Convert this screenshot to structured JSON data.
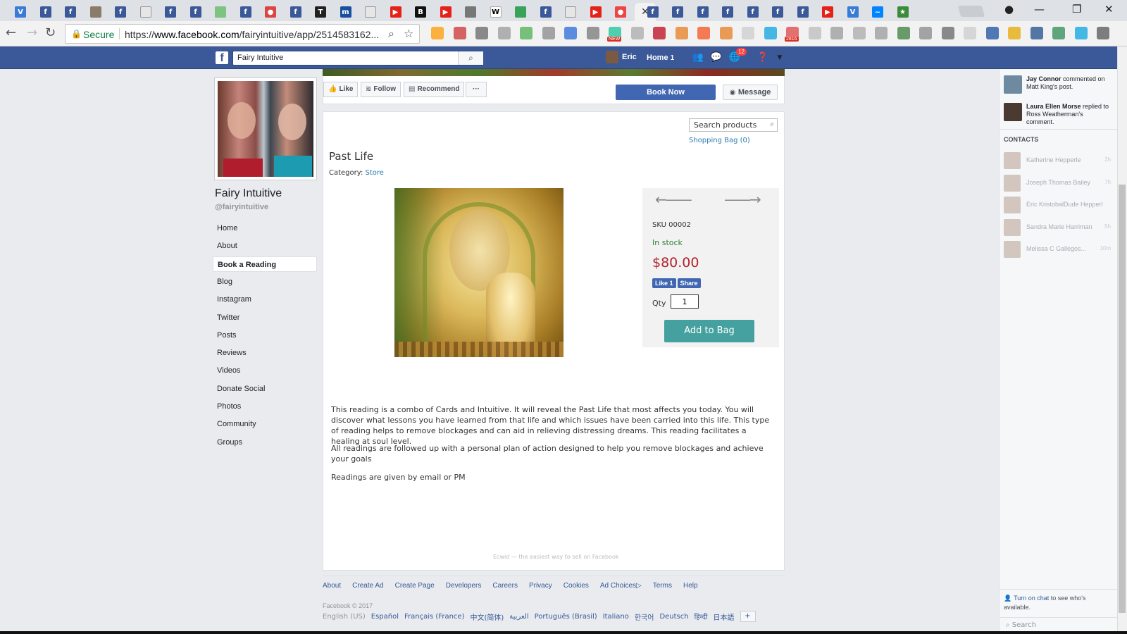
{
  "browser": {
    "address": {
      "secure_label": "Secure",
      "url_prefix": "https://",
      "url_host": "www.facebook.com",
      "url_path": "/fairyintuitive/app/2514583162..."
    },
    "tab_icons": [
      "vivaldi-icon",
      "facebook-icon",
      "facebook-icon",
      "avatar-icon",
      "facebook-icon",
      "doc-icon",
      "facebook-icon",
      "facebook-icon",
      "leaf-icon",
      "facebook-icon",
      "mail-icon",
      "facebook-icon",
      "nyt-icon",
      "news-icon",
      "doc-icon",
      "youtube-icon",
      "bbc-icon",
      "youtube-icon",
      "ship-icon",
      "wikipedia-icon",
      "shield-icon",
      "facebook-icon",
      "doc-icon",
      "youtube-icon",
      "record-icon",
      "facebook-icon",
      "facebook-icon",
      "facebook-icon",
      "facebook-icon",
      "facebook-icon",
      "facebook-icon",
      "facebook-icon",
      "youtube-icon",
      "vivaldi-icon",
      "messenger-icon",
      "star-icon"
    ],
    "extension_badges": {
      "new": "NEW",
      "mail_count": "2816"
    }
  },
  "fb": {
    "search_value": "Fairy Intuitive",
    "user": "Eric",
    "home_label": "Home",
    "home_count": "1",
    "notif_count": "12"
  },
  "page": {
    "name": "Fairy Intuitive",
    "handle": "@fairyintuitive",
    "nav": [
      "Home",
      "About",
      "Book a Reading",
      "Blog",
      "Instagram",
      "Twitter",
      "Posts",
      "Reviews",
      "Videos",
      "Donate Social",
      "Photos",
      "Community",
      "Groups"
    ],
    "actions": {
      "like": "Like",
      "follow": "Follow",
      "recommend": "Recommend",
      "more": "···",
      "book": "Book Now",
      "message": "Message"
    }
  },
  "store": {
    "search_placeholder": "Search products",
    "bag": "Shopping Bag (0)",
    "title": "Past Life",
    "category_label": "Category:",
    "category": "Store",
    "sku": "SKU 00002",
    "stock": "In stock",
    "price": "$80.00",
    "like_label": "Like 1",
    "share_label": "Share",
    "qty_label": "Qty",
    "qty": "1",
    "add_to_bag": "Add to Bag",
    "description": [
      "This reading is a combo of Cards and Intuitive. It will reveal the Past Life that most affects you today. You will discover what lessons you have learned from that life and which issues have been carried into this life. This type of reading helps to remove blockages and can aid in relieving distressing dreams. This reading facilitates a healing at soul level.",
      "All readings are followed up with a personal plan of action designed to help you remove blockages and achieve your goals",
      "Readings are given by email or PM"
    ],
    "ecwid": "Ecwid — the easiest way to sell on Facebook"
  },
  "footer": {
    "links": [
      "About",
      "Create Ad",
      "Create Page",
      "Developers",
      "Careers",
      "Privacy",
      "Cookies",
      "Ad Choices",
      "Terms",
      "Help"
    ],
    "copyright": "Facebook © 2017",
    "current_lang": "English (US)",
    "langs": [
      "Español",
      "Français (France)",
      "中文(简体)",
      "العربية",
      "Português (Brasil)",
      "Italiano",
      "한국어",
      "Deutsch",
      "हिन्दी",
      "日本語"
    ],
    "more_langs": "+"
  },
  "sidebar": {
    "ticker": [
      {
        "name": "Jay Connor",
        "text": " commented on Matt King's post."
      },
      {
        "name": "Laura Ellen Morse",
        "text": " replied to Ross Weatherman's comment."
      }
    ],
    "contacts_header": "CONTACTS",
    "contacts": [
      {
        "name": "Katherine Hepperle",
        "time": "2h"
      },
      {
        "name": "Joseph Thomas Bailey",
        "time": "7h"
      },
      {
        "name": "Eric KristobalDude Hepperle",
        "time": ""
      },
      {
        "name": "Sandra Marie Harriman",
        "time": "5h"
      },
      {
        "name": "Melissa C Gallegos...",
        "time": "10m"
      }
    ],
    "chat_link": "Turn on chat",
    "chat_text": " to see who's available.",
    "search_placeholder": "Search"
  }
}
